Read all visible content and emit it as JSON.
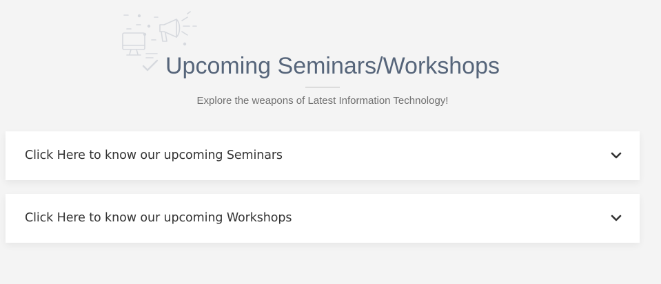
{
  "section": {
    "title": "Upcoming Seminars/Workshops",
    "subtitle": "Explore the weapons of Latest Information Technology!",
    "decoration_icon": "announcement-megaphone-computer-icon"
  },
  "accordion": {
    "items": [
      {
        "label": "Click Here to know our upcoming Seminars",
        "icon": "chevron-down-icon",
        "expanded": false
      },
      {
        "label": "Click Here to know our upcoming Workshops",
        "icon": "chevron-down-icon",
        "expanded": false
      }
    ]
  },
  "colors": {
    "background": "#f4f4f4",
    "title": "#56657a",
    "card": "#ffffff",
    "text": "#333333"
  }
}
